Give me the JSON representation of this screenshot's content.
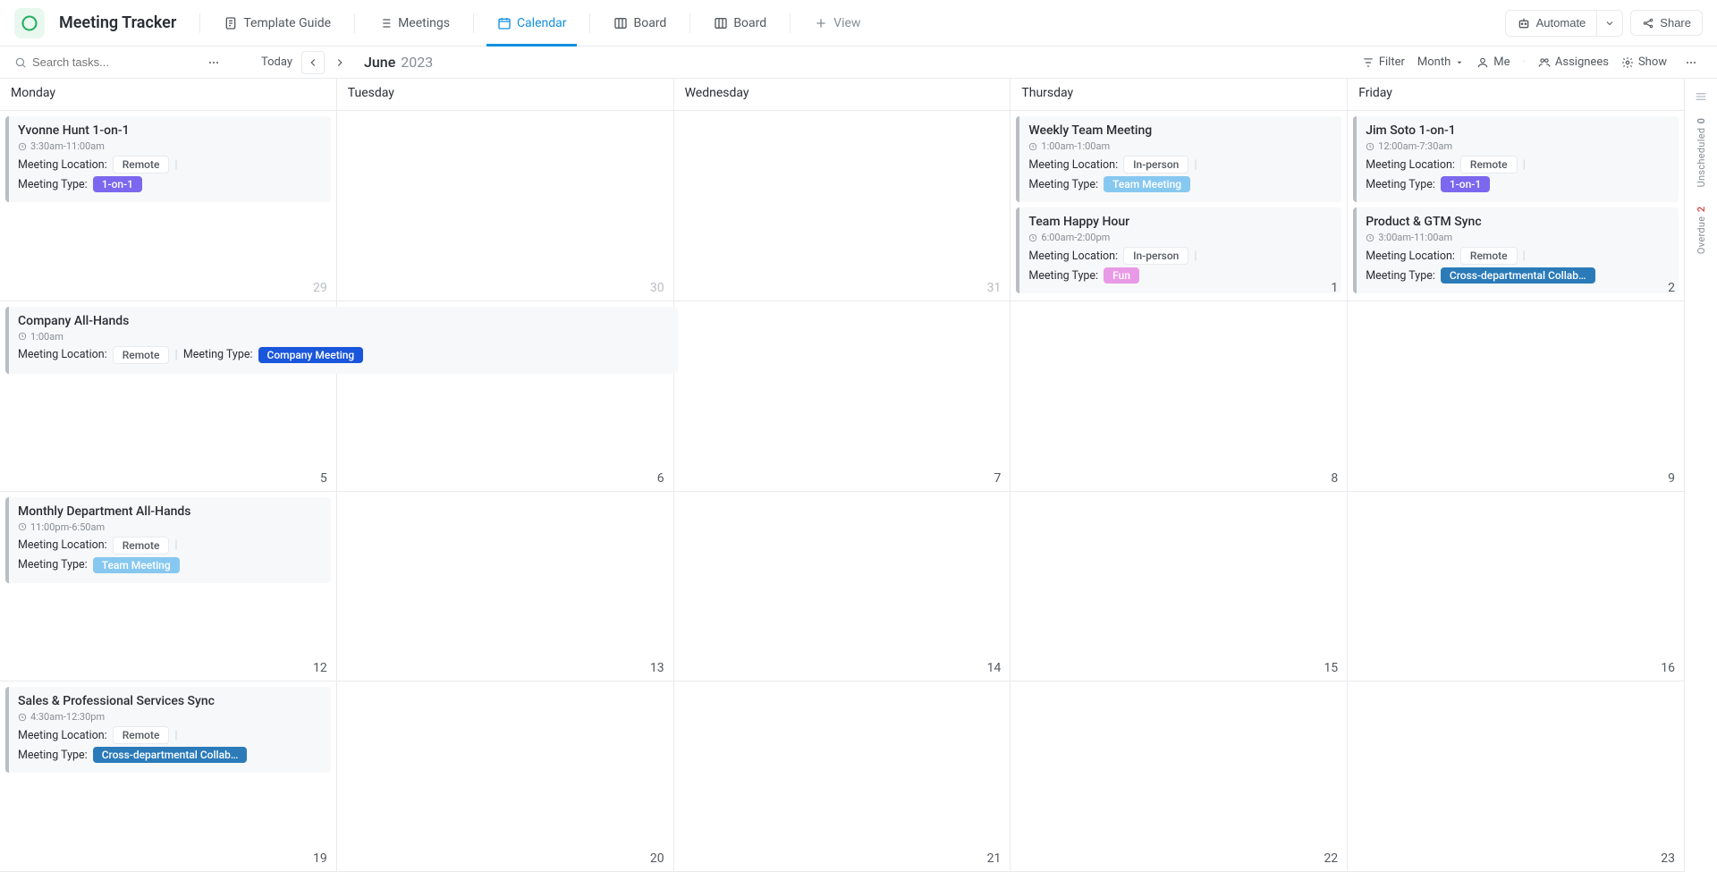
{
  "app": {
    "title": "Meeting Tracker"
  },
  "tabs": {
    "template": "Template Guide",
    "meetings": "Meetings",
    "calendar": "Calendar",
    "board1": "Board",
    "board2": "Board",
    "view": "View"
  },
  "topbar": {
    "automate": "Automate",
    "share": "Share"
  },
  "toolbar": {
    "search_placeholder": "Search tasks...",
    "today": "Today",
    "month": "June",
    "year": "2023",
    "filter": "Filter",
    "period": "Month",
    "me": "Me",
    "assignees": "Assignees",
    "show": "Show"
  },
  "days": {
    "mon": "Monday",
    "tue": "Tuesday",
    "wed": "Wednesday",
    "thu": "Thursday",
    "fri": "Friday"
  },
  "dates": {
    "r0": [
      "29",
      "30",
      "31",
      "1",
      "2"
    ],
    "r1": [
      "5",
      "6",
      "7",
      "8",
      "9"
    ],
    "r2": [
      "12",
      "13",
      "14",
      "15",
      "16"
    ],
    "r3": [
      "19",
      "20",
      "21",
      "22",
      "23"
    ]
  },
  "labels": {
    "location": "Meeting Location:",
    "type": "Meeting Type:"
  },
  "events": {
    "yvonne": {
      "title": "Yvonne Hunt 1-on-1",
      "time": "3:30am-11:00am",
      "loc": "Remote",
      "type": "1-on-1"
    },
    "weekly": {
      "title": "Weekly Team Meeting",
      "time": "1:00am-1:00am",
      "loc": "In-person",
      "type": "Team Meeting"
    },
    "happy": {
      "title": "Team Happy Hour",
      "time": "6:00am-2:00pm",
      "loc": "In-person",
      "type": "Fun"
    },
    "jim": {
      "title": "Jim Soto 1-on-1",
      "time": "12:00am-7:30am",
      "loc": "Remote",
      "type": "1-on-1"
    },
    "gtm": {
      "title": "Product & GTM Sync",
      "time": "3:00am-11:00am",
      "loc": "Remote",
      "type": "Cross-departmental Collab…"
    },
    "allhands": {
      "title": "Company All-Hands",
      "time": "1:00am",
      "loc": "Remote",
      "type": "Company Meeting"
    },
    "dept": {
      "title": "Monthly Department All-Hands",
      "time": "11:00pm-6:50am",
      "loc": "Remote",
      "type": "Team Meeting"
    },
    "sales": {
      "title": "Sales & Professional Services Sync",
      "time": "4:30am-12:30pm",
      "loc": "Remote",
      "type": "Cross-departmental Collab…"
    }
  },
  "side": {
    "unscheduled_count": "0",
    "unscheduled": "Unscheduled",
    "overdue_count": "2",
    "overdue": "Overdue"
  }
}
